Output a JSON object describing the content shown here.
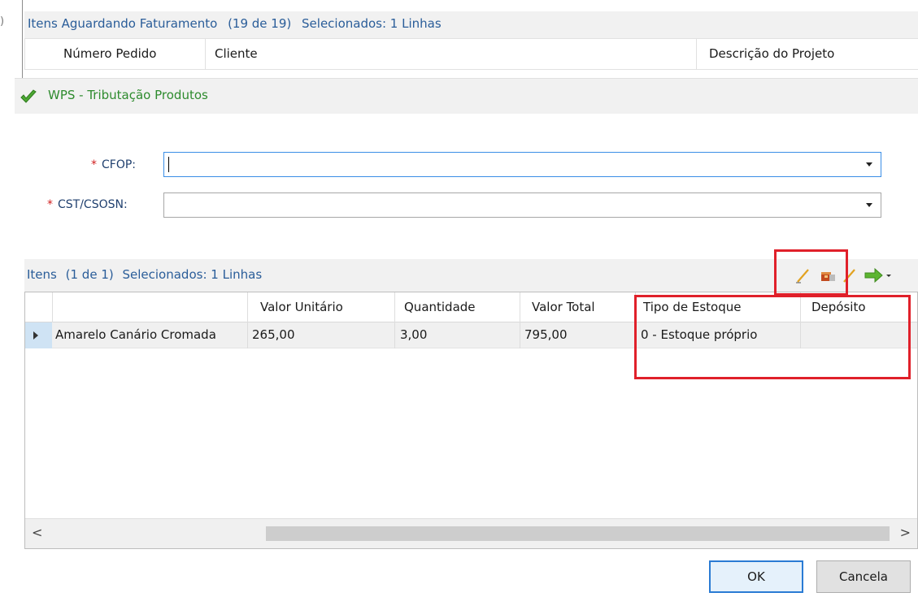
{
  "background_grid": {
    "title": "Itens Aguardando Faturamento",
    "count": "(19 de 19)",
    "selected": "Selecionados: 1 Linhas",
    "columns": [
      "Número Pedido",
      "Cliente",
      "Descrição do Projeto"
    ]
  },
  "modal": {
    "title": "WPS - Tributação Produtos",
    "title_icon": "check-icon",
    "fields": {
      "cfop": {
        "required_mark": "*",
        "label": "CFOP:",
        "value": ""
      },
      "cst": {
        "required_mark": "*",
        "label": "CST/CSOSN:",
        "value": ""
      }
    },
    "items_grid": {
      "title": "Itens",
      "count": "(1 de 1)",
      "selected": "Selecionados: 1 Linhas",
      "toolbar_icons": [
        "edit-pencil-icon",
        "package-icon",
        "edit-pencil-icon",
        "green-arrow-icon"
      ],
      "columns": [
        "",
        "Valor Unitário",
        "Quantidade",
        "Valor Total",
        "Tipo de Estoque",
        "Depósito"
      ],
      "rows": [
        {
          "produto": "Amarelo Canário Cromada",
          "valor_unitario": "265,00",
          "quantidade": "3,00",
          "valor_total": "795,00",
          "tipo_estoque": "0 - Estoque próprio",
          "deposito": ""
        }
      ],
      "scroll_left": "<",
      "scroll_right": ">"
    },
    "buttons": {
      "ok": "OK",
      "cancel": "Cancela"
    }
  },
  "colors": {
    "highlight_border": "#e0202a",
    "title_green": "#2e8b2e",
    "header_blue": "#2a5d99",
    "focus_blue": "#2a7bd4"
  }
}
